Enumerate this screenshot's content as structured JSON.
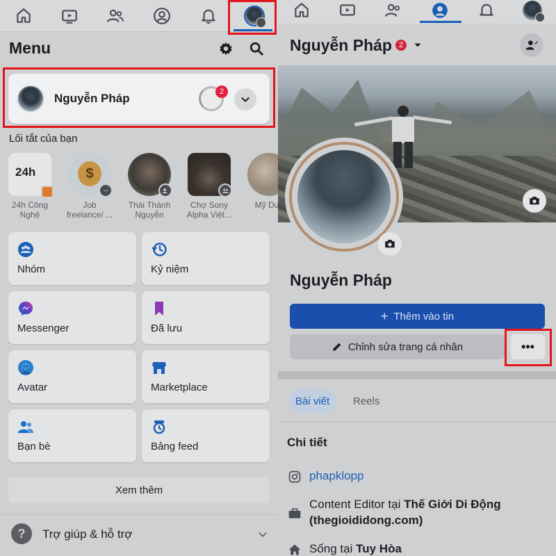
{
  "left": {
    "menu_title": "Menu",
    "profile_name": "Nguyễn Pháp",
    "story_badge": "2",
    "shortcuts_title": "Lối tắt của bạn",
    "shortcuts": [
      {
        "line1": "24h Công",
        "line2": "Nghệ",
        "thumb_text": "24h"
      },
      {
        "line1": "Job",
        "line2": "freelance/ ...",
        "thumb_text": "$"
      },
      {
        "line1": "Thái Thành",
        "line2": "Nguyễn",
        "thumb_text": ""
      },
      {
        "line1": "Chợ Sony",
        "line2": "Alpha Việt...",
        "thumb_text": ""
      },
      {
        "line1": "Mỹ Duy",
        "line2": "",
        "thumb_text": ""
      }
    ],
    "tiles": [
      {
        "label": "Nhóm"
      },
      {
        "label": "Kỷ niệm"
      },
      {
        "label": "Messenger"
      },
      {
        "label": "Đã lưu"
      },
      {
        "label": "Avatar"
      },
      {
        "label": "Marketplace"
      },
      {
        "label": "Bạn bè"
      },
      {
        "label": "Bảng feed"
      }
    ],
    "see_more": "Xem thêm",
    "help": "Trợ giúp & hỗ trợ"
  },
  "right": {
    "header_name": "Nguyễn Pháp",
    "header_badge": "2",
    "profile_name": "Nguyễn Pháp",
    "add_story": "Thêm vào tin",
    "edit_profile": "Chỉnh sửa trang cá nhân",
    "more": "•••",
    "tabs": {
      "posts": "Bài viết",
      "reels": "Reels"
    },
    "details_title": "Chi tiết",
    "details": {
      "instagram": "phapklopp",
      "work_prefix": "Content Editor tại ",
      "work_company": "Thế Giới Di Động",
      "work_site": "(thegioididong.com)",
      "lives_prefix": "Sống tại ",
      "lives_city": "Tuy Hòa"
    }
  },
  "colors": {
    "accent": "#1b5fb8",
    "highlight": "#e3141b",
    "badge": "#e41e3f",
    "primary_button": "#1b4fae"
  },
  "icons": {
    "tabbar": [
      "home-icon",
      "video-icon",
      "friends-icon",
      "profile-icon",
      "bell-icon",
      "menu-avatar-icon"
    ],
    "tiles": [
      "groups-icon",
      "memories-icon",
      "messenger-icon",
      "saved-icon",
      "avatar-icon",
      "marketplace-icon",
      "friends-icon",
      "feeds-icon"
    ],
    "details": [
      "instagram-icon",
      "briefcase-icon",
      "home-icon"
    ]
  }
}
